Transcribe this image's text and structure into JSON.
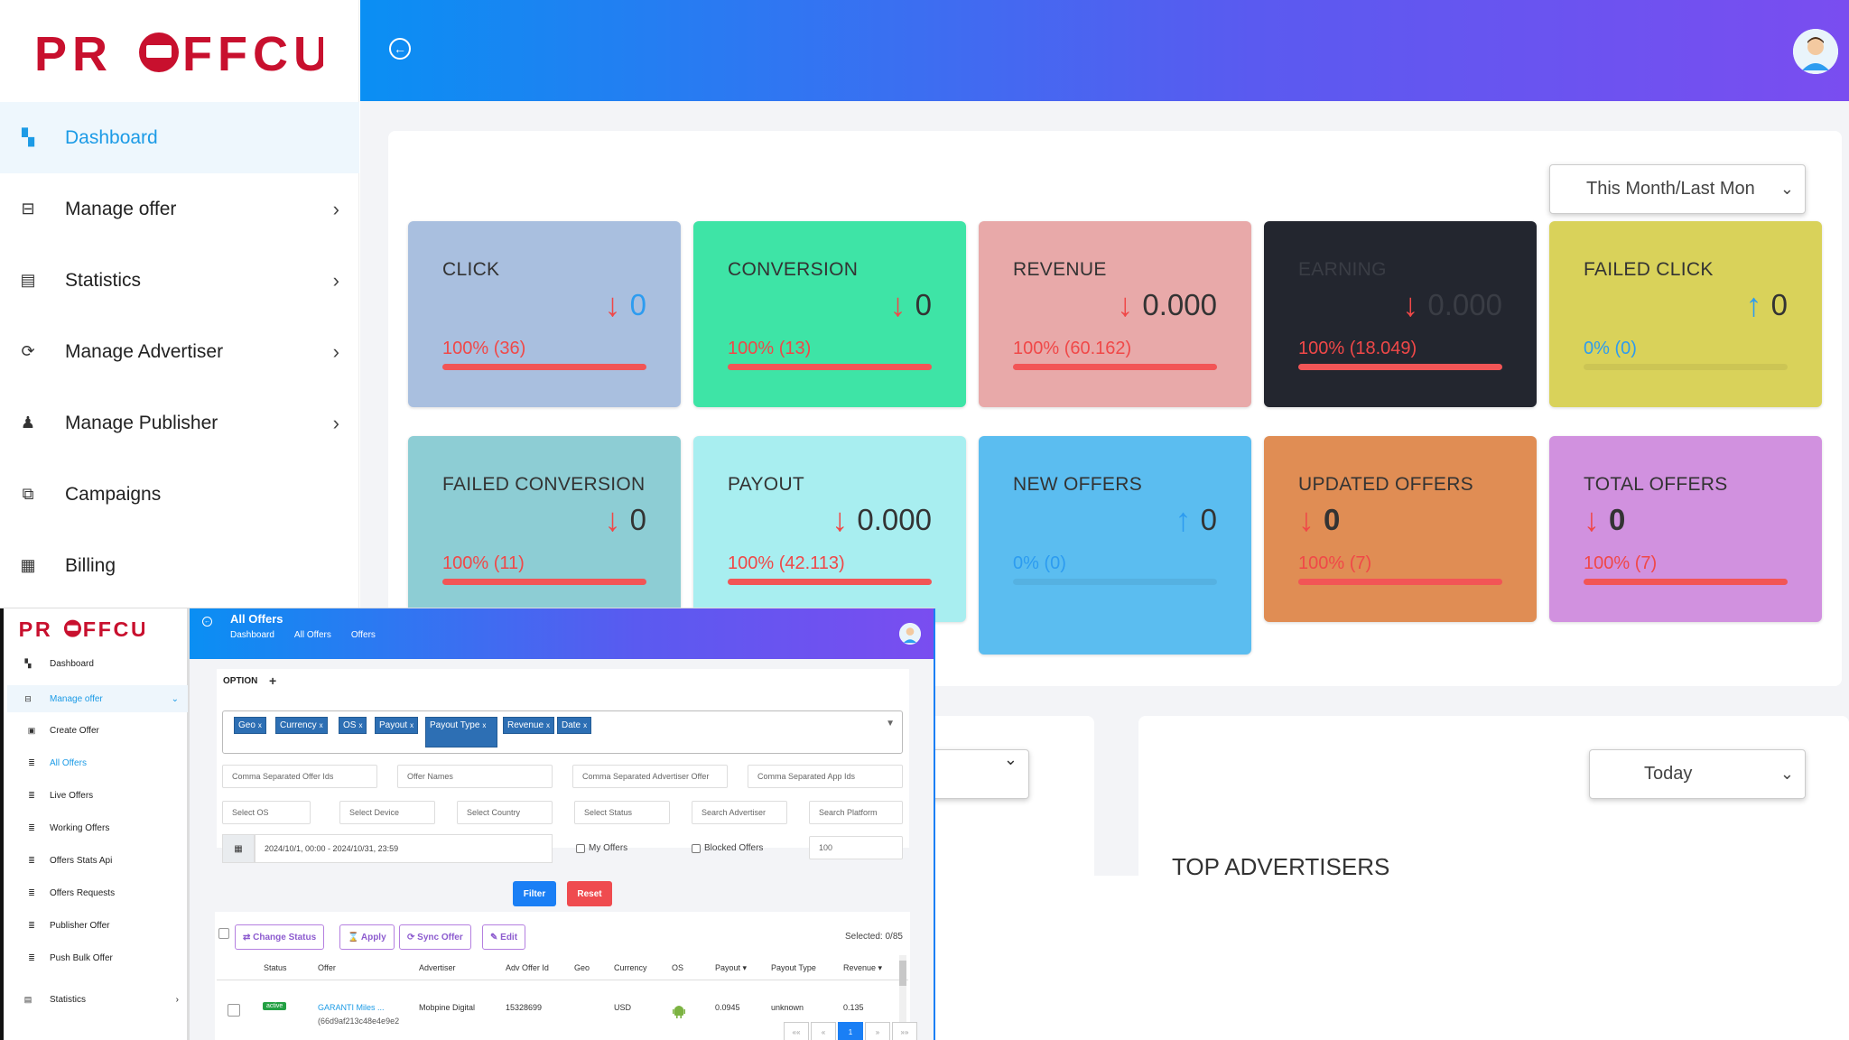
{
  "brand": {
    "logo_text": "PROFFCUS",
    "accent": "#c8102e"
  },
  "sidebar": {
    "items": [
      {
        "label": "Dashboard",
        "icon": "dashboard-icon",
        "active": true
      },
      {
        "label": "Manage offer",
        "icon": "offer-icon"
      },
      {
        "label": "Statistics",
        "icon": "clipboard-icon"
      },
      {
        "label": "Manage Advertiser",
        "icon": "advertiser-icon"
      },
      {
        "label": "Manage Publisher",
        "icon": "publisher-icon"
      },
      {
        "label": "Campaigns",
        "icon": "campaigns-icon"
      },
      {
        "label": "Billing",
        "icon": "billing-icon"
      }
    ]
  },
  "dashboard": {
    "period_select": "This Month/Last Mon",
    "cards": [
      {
        "title": "CLICK",
        "value": "0",
        "direction": "down",
        "percent": "100% (36)",
        "fill": 1.0,
        "bg": "#a9bfdf",
        "value_color": "#2d9cf0"
      },
      {
        "title": "CONVERSION",
        "value": "0",
        "direction": "down",
        "percent": "100% (13)",
        "fill": 1.0,
        "bg": "#3ee4a6",
        "value_color": "#333"
      },
      {
        "title": "REVENUE",
        "value": "0.000",
        "direction": "down",
        "percent": "100% (60.162)",
        "fill": 1.0,
        "bg": "#e8a9a9",
        "value_color": "#333"
      },
      {
        "title": "EARNING",
        "value": "0.000",
        "direction": "down",
        "percent": "100% (18.049)",
        "fill": 1.0,
        "bg": "#23262f",
        "value_color": "#3a3d45"
      },
      {
        "title": "FAILED CLICK",
        "value": "0",
        "direction": "up",
        "percent": "0% (0)",
        "fill": 0.0,
        "bg": "#d9d25a",
        "value_color": "#333"
      },
      {
        "title": "FAILED CONVERSION",
        "value": "0",
        "direction": "down",
        "percent": "100% (11)",
        "fill": 1.0,
        "bg": "#8dcdd4",
        "value_color": "#333"
      },
      {
        "title": "PAYOUT",
        "value": "0.000",
        "direction": "down",
        "percent": "100% (42.113)",
        "fill": 1.0,
        "bg": "#a8eef0",
        "value_color": "#333"
      },
      {
        "title": "NEW OFFERS",
        "value": "0",
        "direction": "up",
        "percent": "0% (0)",
        "fill": 0.0,
        "bg": "#5bbdf0",
        "value_color": "#333"
      },
      {
        "title": "UPDATED OFFERS",
        "value": "0",
        "direction": "down",
        "percent": "100% (7)",
        "fill": 1.0,
        "bg": "#e08d54",
        "value_color": "#333"
      },
      {
        "title": "TOTAL OFFERS",
        "value": "0",
        "direction": "down",
        "percent": "100% (7)",
        "fill": 1.0,
        "bg": "#d191df",
        "value_color": "#333"
      }
    ],
    "today_select": "Today",
    "top_advertisers_title": "TOP ADVERTISERS"
  },
  "inset": {
    "title": "All Offers",
    "breadcrumb": [
      "Dashboard",
      "All Offers",
      "Offers"
    ],
    "sidebar": [
      {
        "label": "Dashboard",
        "icon": "dashboard-icon",
        "sub": false
      },
      {
        "label": "Manage offer",
        "icon": "offer-icon",
        "sub": false,
        "active": true
      },
      {
        "label": "Create Offer",
        "icon": "plus-square-icon",
        "sub": true
      },
      {
        "label": "All Offers",
        "icon": "list-icon",
        "sub": true,
        "active": true
      },
      {
        "label": "Live Offers",
        "icon": "list-icon",
        "sub": true
      },
      {
        "label": "Working Offers",
        "icon": "list-icon",
        "sub": true
      },
      {
        "label": "Offers Stats Api",
        "icon": "list-icon",
        "sub": true
      },
      {
        "label": "Offers Requests",
        "icon": "list-icon",
        "sub": true
      },
      {
        "label": "Publisher Offer",
        "icon": "list-icon",
        "sub": true
      },
      {
        "label": "Push Bulk Offer",
        "icon": "list-icon",
        "sub": true
      },
      {
        "label": "Statistics",
        "icon": "clipboard-icon",
        "sub": false
      }
    ],
    "option_label": "OPTION",
    "tags": [
      "Geo",
      "Currency",
      "OS",
      "Payout",
      "Payout Type",
      "Revenue",
      "Date"
    ],
    "tag_remove": "x",
    "placeholders": {
      "offer_ids": "Comma Separated Offer Ids",
      "offer_names": "Offer Names",
      "adv_offer": "Comma Separated Advertiser Offer",
      "app_ids": "Comma Separated App Ids",
      "os": "Select OS",
      "device": "Select Device",
      "country": "Select Country",
      "status": "Select Status",
      "advertiser": "Search Advertiser",
      "platform": "Search Platform"
    },
    "date_range": "2024/10/1, 00:00 - 2024/10/31, 23:59",
    "my_offers": "My Offers",
    "blocked_offers": "Blocked Offers",
    "limit": "100",
    "filter_btn": "Filter",
    "reset_btn": "Reset",
    "actions": [
      "⇄ Change Status",
      "⌛ Apply",
      "⟳ Sync Offer",
      "✎ Edit"
    ],
    "selected": "Selected: 0/85",
    "columns": [
      "Status",
      "Offer",
      "Advertiser",
      "Adv Offer Id",
      "Geo",
      "Currency",
      "OS",
      "Payout ▾",
      "Payout Type",
      "Revenue ▾"
    ],
    "row": {
      "status": "active",
      "offer": "GARANTI Miles ...",
      "offer_id": "(66d9af213c48e4e9e2",
      "advertiser": "Mobpine Digital",
      "adv_offer_id": "15328699",
      "geo": "",
      "currency": "USD",
      "payout": "0.0945",
      "payout_type": "unknown",
      "revenue": "0.135"
    },
    "pager": [
      "««",
      "«",
      "1",
      "»",
      "»»"
    ]
  }
}
